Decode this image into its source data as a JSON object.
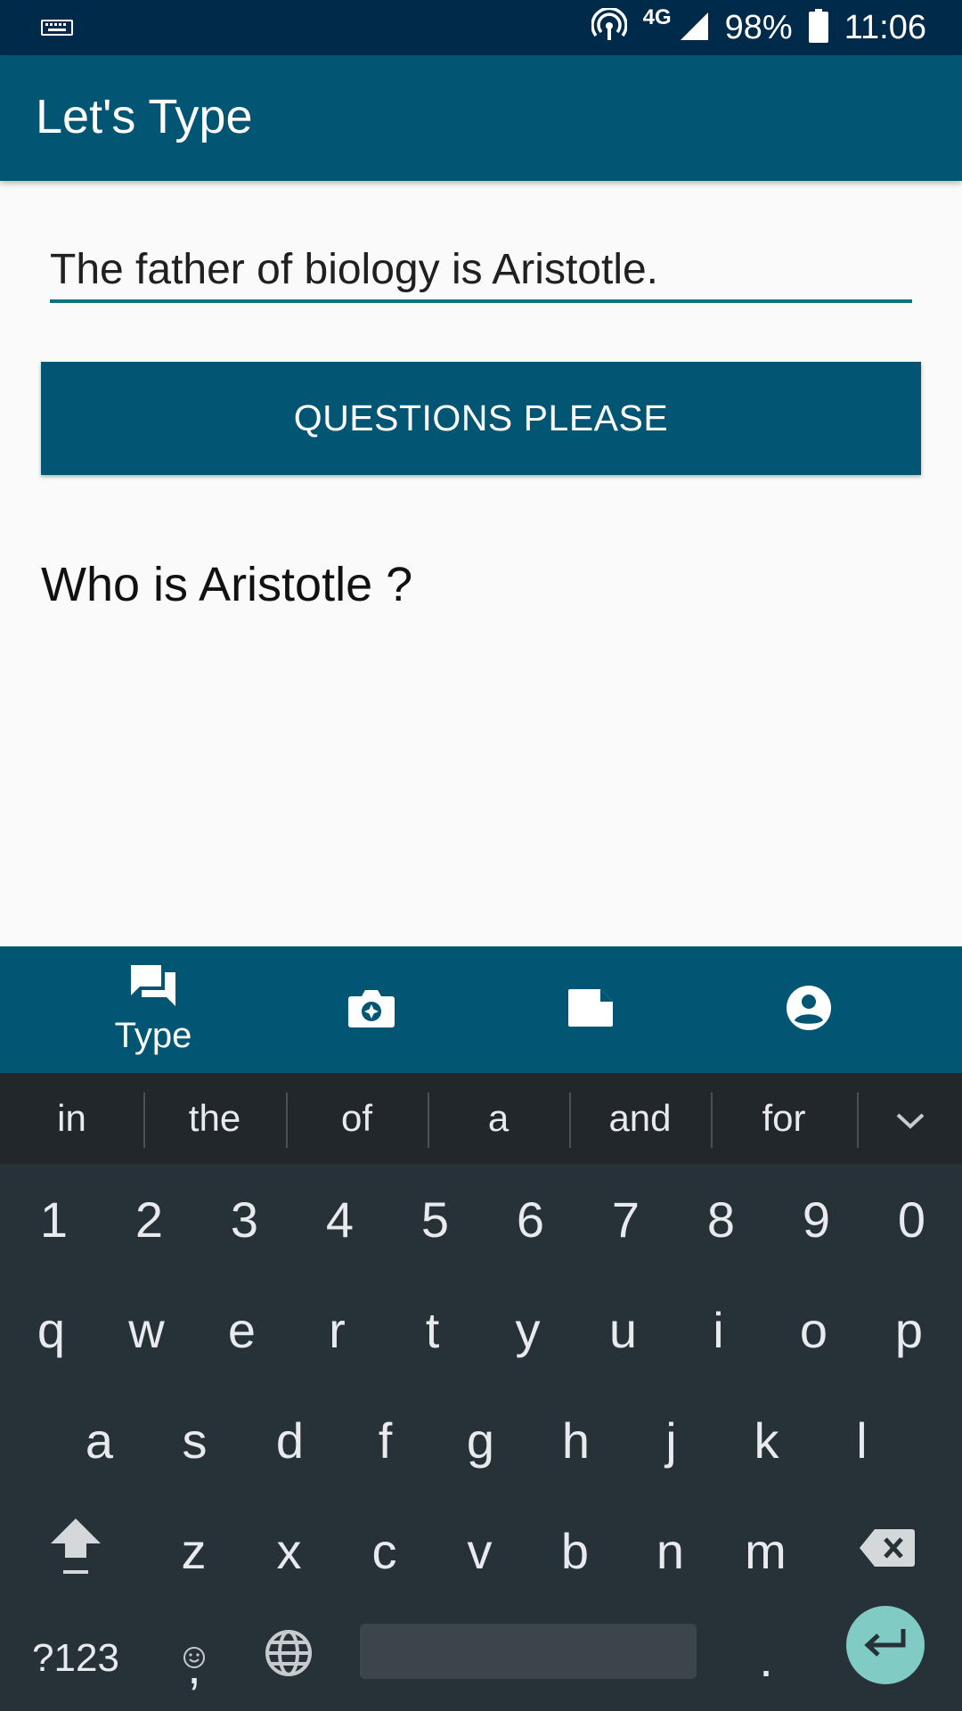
{
  "status_bar": {
    "network": "4G",
    "battery": "98%",
    "time": "11:06",
    "icons": [
      "keyboard-icon",
      "hotspot-icon",
      "signal-icon",
      "battery-icon"
    ]
  },
  "app_bar": {
    "title": "Let's Type"
  },
  "main": {
    "input_value": "The father of biology is Aristotle.",
    "button_label": "QUESTIONS PLEASE",
    "question": "Who is Aristotle ?"
  },
  "bottom_nav": {
    "items": [
      {
        "label": "Type",
        "icon": "chat-icon",
        "active": true
      },
      {
        "label": "",
        "icon": "camera-icon",
        "active": false
      },
      {
        "label": "",
        "icon": "note-icon",
        "active": false
      },
      {
        "label": "",
        "icon": "account-icon",
        "active": false
      }
    ]
  },
  "keyboard": {
    "suggestions": [
      "in",
      "the",
      "of",
      "a",
      "and",
      "for"
    ],
    "number_row": [
      "1",
      "2",
      "3",
      "4",
      "5",
      "6",
      "7",
      "8",
      "9",
      "0"
    ],
    "row1": [
      "q",
      "w",
      "e",
      "r",
      "t",
      "y",
      "u",
      "i",
      "o",
      "p"
    ],
    "row2": [
      "a",
      "s",
      "d",
      "f",
      "g",
      "h",
      "j",
      "k",
      "l"
    ],
    "row3": [
      "z",
      "x",
      "c",
      "v",
      "b",
      "n",
      "m"
    ],
    "symbols_key": "?123",
    "comma_key": ",",
    "period_key": "."
  },
  "colors": {
    "status_bar": "#002a4a",
    "primary": "#025674",
    "input_underline": "#0e7287",
    "keyboard_bg": "#263238",
    "enter_key": "#80cbc4"
  }
}
